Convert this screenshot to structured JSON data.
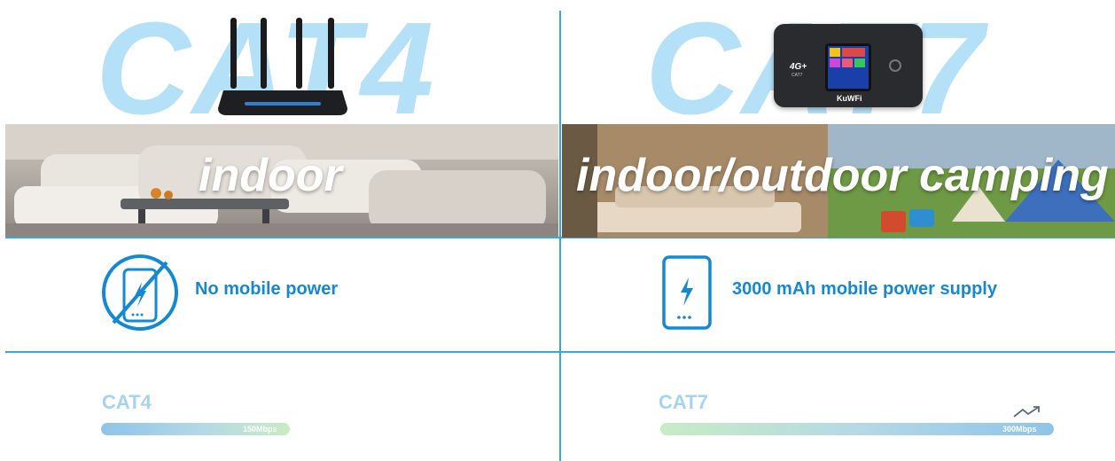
{
  "left": {
    "title": "CAT4",
    "scene_label": "indoor",
    "feature": "No mobile power",
    "speed_label": "CAT4",
    "speed_value": "150Mbps"
  },
  "right": {
    "title": "CAT7",
    "scene_label": "indoor/outdoor camping",
    "feature": "3000 mAh mobile power supply",
    "speed_label": "CAT7",
    "speed_value": "300Mbps",
    "device_brand": "KuWFi",
    "device_badge": "4G+",
    "device_badge_sub": "CAT7"
  },
  "colors": {
    "accent": "#1489d2",
    "divider": "#3aa9d6",
    "title_fill": "#b4e0f8"
  }
}
